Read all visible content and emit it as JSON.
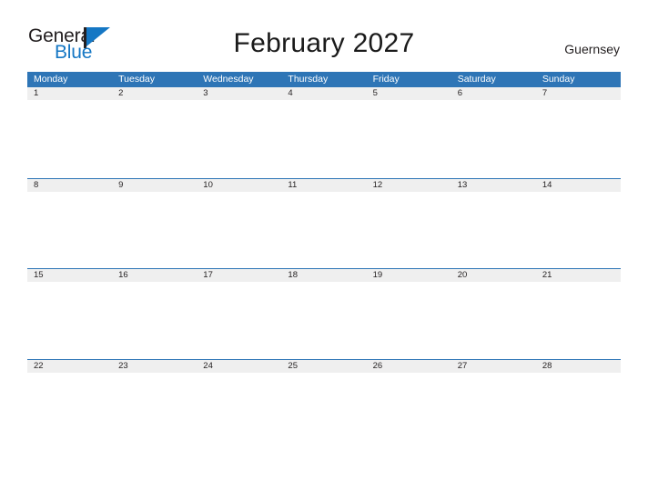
{
  "brand": {
    "word_general": "General",
    "word_blue": "Blue",
    "triangle_color": "#1577c4",
    "text_color": "#231f20"
  },
  "header": {
    "title": "February 2027",
    "locale": "Guernsey"
  },
  "theme": {
    "header_blue": "#2e75b6",
    "date_band_gray": "#efefef",
    "rule_blue": "#2e75b6",
    "page_background": "#ffffff",
    "text_dark": "#231f20"
  },
  "calendar": {
    "month": "February",
    "year": "2027",
    "weekday_headers": [
      "Monday",
      "Tuesday",
      "Wednesday",
      "Thursday",
      "Friday",
      "Saturday",
      "Sunday"
    ],
    "weeks": [
      {
        "dates": [
          "1",
          "2",
          "3",
          "4",
          "5",
          "6",
          "7"
        ]
      },
      {
        "dates": [
          "8",
          "9",
          "10",
          "11",
          "12",
          "13",
          "14"
        ]
      },
      {
        "dates": [
          "15",
          "16",
          "17",
          "18",
          "19",
          "20",
          "21"
        ]
      },
      {
        "dates": [
          "22",
          "23",
          "24",
          "25",
          "26",
          "27",
          "28"
        ]
      }
    ]
  }
}
